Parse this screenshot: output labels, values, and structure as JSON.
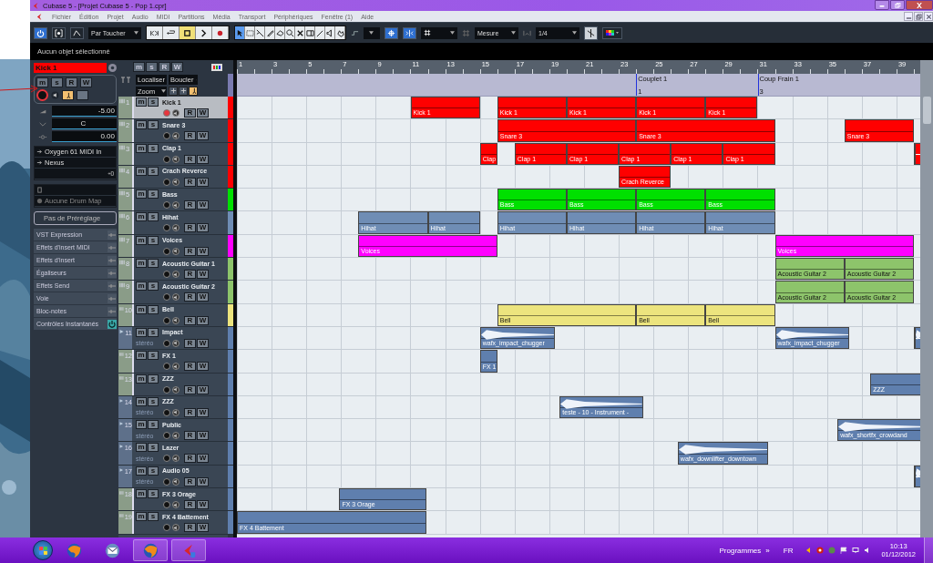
{
  "window": {
    "title": "Cubase 5 - [Projet Cubase 5 - Pop 1.cpr]"
  },
  "menu": [
    "Fichier",
    "Édition",
    "Projet",
    "Audio",
    "MIDI",
    "Partitions",
    "Média",
    "Transport",
    "Périphériques",
    "Fenêtre (1)",
    "Aide"
  ],
  "toolbar": {
    "automation_mode": "Par Toucher",
    "grid_type": "Mesure",
    "quantize": "1/4"
  },
  "info_line": "Aucun objet sélectionné",
  "inspector": {
    "track_name": "Kick 1",
    "mute": "m",
    "solo": "s",
    "read": "R",
    "write": "W",
    "volume": "-5.00",
    "pan": "C",
    "delay": "0.00",
    "input": "Oxygen 61 MIDI In",
    "output": "Nexus",
    "drum_map": "Aucune Drum Map",
    "preset": "Pas de Préréglage",
    "sections": [
      {
        "label": "VST Expression",
        "active": false
      },
      {
        "label": "Effets d'insert MIDI",
        "active": false
      },
      {
        "label": "Effets d'insert",
        "active": false
      },
      {
        "label": "Égaliseurs",
        "active": false
      },
      {
        "label": "Effets Send",
        "active": false
      },
      {
        "label": "Voie",
        "active": false
      },
      {
        "label": "Bloc-notes",
        "active": false
      },
      {
        "label": "Contrôles Instantanés",
        "active": true
      }
    ]
  },
  "track_header": {
    "buttons": [
      "m",
      "s",
      "R",
      "W"
    ],
    "locate": "Localiser",
    "loop": "Boucler",
    "zoom": "Zoom"
  },
  "ruler": [
    "1",
    "3",
    "5",
    "7",
    "9",
    "11",
    "13",
    "15",
    "17",
    "19",
    "21",
    "23",
    "25",
    "27",
    "29",
    "31",
    "33",
    "35",
    "37",
    "39"
  ],
  "markers": [
    {
      "name": "Couplet 1",
      "number": "1"
    },
    {
      "name": "Coup Frain 1",
      "number": "3"
    }
  ],
  "tracks": [
    {
      "number": "1",
      "name": "Kick 1",
      "kind": "midi",
      "mute": "m",
      "solo": "s",
      "read": "R",
      "write": "W",
      "color": "#ff0000",
      "selected": true,
      "record": true,
      "parts": [
        {
          "label": "Kick 1"
        },
        {
          "label": "Kick 1"
        },
        {
          "label": "Kick 1"
        },
        {
          "label": "Kick 1"
        },
        {
          "label": "Kick 1"
        }
      ]
    },
    {
      "number": "2",
      "name": "Snare 3",
      "kind": "midi",
      "mute": "m",
      "solo": "s",
      "read": "R",
      "write": "W",
      "color": "#ff0000",
      "selected": false,
      "record": false,
      "parts": [
        {
          "label": "Snare 3"
        },
        {
          "label": "Snare 3"
        },
        {
          "label": "Snare 3"
        }
      ]
    },
    {
      "number": "3",
      "name": "Clap 1",
      "kind": "midi",
      "mute": "m",
      "solo": "s",
      "read": "R",
      "write": "W",
      "color": "#ff0000",
      "selected": false,
      "record": false,
      "parts": [
        {
          "label": "Clap"
        },
        {
          "label": "Clap 1"
        },
        {
          "label": "Clap 1"
        },
        {
          "label": "Clap 1"
        },
        {
          "label": "Clap 1"
        },
        {
          "label": "Clap 1"
        },
        {
          "kind": "cut"
        }
      ]
    },
    {
      "number": "4",
      "name": "Crach Reverce",
      "kind": "midi",
      "mute": "m",
      "solo": "s",
      "read": "R",
      "write": "W",
      "color": "#ff0000",
      "selected": false,
      "record": false,
      "parts": [
        {
          "label": "Crach Reverce"
        }
      ]
    },
    {
      "number": "5",
      "name": "Bass",
      "kind": "midi",
      "mute": "m",
      "solo": "s",
      "read": "R",
      "write": "W",
      "color": "#00e000",
      "selected": false,
      "record": false,
      "parts": [
        {
          "label": "Bass"
        },
        {
          "label": "Bass"
        },
        {
          "label": "Bass"
        },
        {
          "label": "Bass"
        }
      ]
    },
    {
      "number": "6",
      "name": "Hihat",
      "kind": "midi",
      "mute": "m",
      "solo": "s",
      "read": "R",
      "write": "W",
      "color": "#6f8db5",
      "selected": false,
      "record": false,
      "parts": [
        {
          "label": "Hihat"
        },
        {
          "label": "Hihat"
        },
        {
          "label": "Hihat"
        },
        {
          "label": "Hihat"
        },
        {
          "label": "Hihat"
        },
        {
          "label": "Hihat"
        }
      ]
    },
    {
      "number": "7",
      "name": "Voices",
      "kind": "midi",
      "mute": "m",
      "solo": "s",
      "read": "R",
      "write": "W",
      "color": "#ff00ff",
      "selected": false,
      "record": false,
      "parts": [
        {
          "label": "Voices"
        },
        {
          "label": "Voices"
        }
      ]
    },
    {
      "number": "8",
      "name": "Acoustic Guitar 1",
      "kind": "midi",
      "mute": "m",
      "solo": "s",
      "read": "R",
      "write": "W",
      "color": "#8dc46b",
      "selected": false,
      "record": false,
      "parts": [
        {
          "label": "Acoustic Guitar 2"
        },
        {
          "label": "Acoustic Guitar 2"
        }
      ]
    },
    {
      "number": "9",
      "name": "Acoustic Guitar 2",
      "kind": "midi",
      "mute": "m",
      "solo": "s",
      "read": "R",
      "write": "W",
      "color": "#8dc46b",
      "selected": false,
      "record": false,
      "parts": [
        {
          "label": "Acoustic Guitar 2"
        },
        {
          "label": "Acoustic Guitar 2"
        }
      ]
    },
    {
      "number": "10",
      "name": "Bell",
      "kind": "midi",
      "mute": "m",
      "solo": "s",
      "read": "R",
      "write": "W",
      "color": "#ece47e",
      "selected": false,
      "record": false,
      "parts": [
        {
          "label": "Bell"
        },
        {
          "label": "Bell"
        },
        {
          "label": "Bell"
        }
      ]
    },
    {
      "number": "11",
      "name": "Impact",
      "kind": "audio",
      "format": "stéréo",
      "mute": "m",
      "solo": "s",
      "read": "R",
      "write": "W",
      "color": "#5f7fae",
      "selected": false,
      "record": false,
      "parts": [
        {
          "label": "wafx_impact_chugger"
        },
        {
          "label": "wafx_impact_chugger"
        },
        {
          "kind": "cut"
        }
      ]
    },
    {
      "number": "12",
      "name": "FX 1",
      "kind": "midi",
      "mute": "m",
      "solo": "s",
      "read": "R",
      "write": "W",
      "color": "#5f7fae",
      "selected": false,
      "record": false,
      "parts": [
        {
          "label": "FX 1"
        }
      ]
    },
    {
      "number": "13",
      "name": "ZZZ",
      "kind": "midi",
      "mute": "m",
      "solo": "s",
      "read": "R",
      "write": "W",
      "color": "#5f7fae",
      "selected": false,
      "record": false,
      "parts": [
        {
          "label": "ZZZ"
        }
      ]
    },
    {
      "number": "14",
      "name": "ZZZ",
      "kind": "audio",
      "format": "stéréo",
      "mute": "m",
      "solo": "s",
      "read": "R",
      "write": "W",
      "color": "#5f7fae",
      "selected": false,
      "record": false,
      "parts": [
        {
          "label": "teste - 10 - Instrument -"
        }
      ]
    },
    {
      "number": "15",
      "name": "Public",
      "kind": "audio",
      "format": "stéréo",
      "mute": "m",
      "solo": "s",
      "read": "R",
      "write": "W",
      "color": "#5f7fae",
      "selected": false,
      "record": false,
      "parts": [
        {
          "label": "wafx_shortfx_crowdand"
        }
      ]
    },
    {
      "number": "16",
      "name": "Lazer",
      "kind": "audio",
      "format": "stéréo",
      "mute": "m",
      "solo": "s",
      "read": "R",
      "write": "W",
      "color": "#5f7fae",
      "selected": false,
      "record": false,
      "parts": [
        {
          "label": "wafx_downlifter_downtown"
        }
      ]
    },
    {
      "number": "17",
      "name": "Audio 05",
      "kind": "audio",
      "format": "stéréo",
      "mute": "m",
      "solo": "s",
      "read": "R",
      "write": "W",
      "color": "#5f7fae",
      "selected": false,
      "record": false,
      "parts": [
        {
          "kind": "cut"
        }
      ]
    },
    {
      "number": "18",
      "name": "FX 3 Orage",
      "kind": "midi",
      "mute": "m",
      "solo": "s",
      "read": "R",
      "write": "W",
      "color": "#5f7fae",
      "selected": false,
      "record": false,
      "parts": [
        {
          "label": "FX 3 Orage"
        }
      ]
    },
    {
      "number": "19",
      "name": "FX 4 Battement",
      "kind": "midi",
      "mute": "m",
      "solo": "s",
      "read": "R",
      "write": "W",
      "color": "#5f7fae",
      "selected": false,
      "record": false,
      "parts": [
        {
          "label": "FX 4 Battement"
        }
      ]
    }
  ],
  "taskbar": {
    "programs": "Programmes",
    "more": "»",
    "language": "FR",
    "time": "10:13",
    "date": "01/12/2012"
  }
}
